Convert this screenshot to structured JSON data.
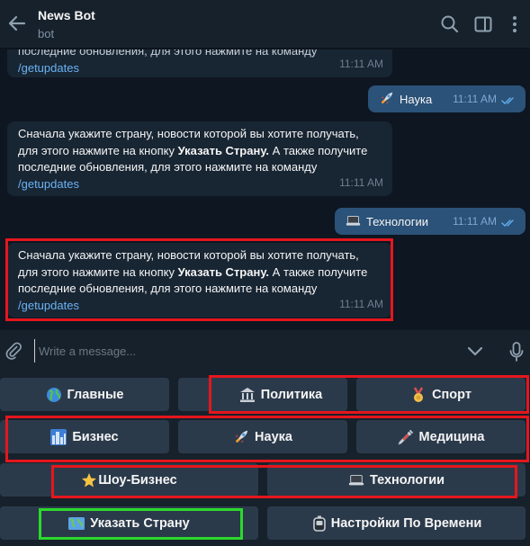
{
  "header": {
    "title": "News Bot",
    "subtitle": "bot"
  },
  "chat": {
    "top_message": {
      "line1": "последние обновления, для этого нажмите на команду",
      "cmd": "/getupdates",
      "time": "11:11 AM"
    },
    "out1": {
      "text": "Наука",
      "time": "11:11 AM"
    },
    "msg2": {
      "line1": "Сначала укажите страну, новости которой вы хотите получать,",
      "line2a": "для этого нажмите на кнопку ",
      "line2b": "Указать Страну.",
      "line2c": " А также получите",
      "line3": "последние обновления, для этого нажмите на команду",
      "cmd": "/getupdates",
      "time": "11:11 AM"
    },
    "out2": {
      "text": "Технологии",
      "time": "11:11 AM"
    },
    "msg3": {
      "line1": "Сначала укажите страну, новости которой вы хотите получать,",
      "line2a": "для этого нажмите на кнопку ",
      "line2b": "Указать Страну.",
      "line2c": " А также получите",
      "line3": "последние обновления, для этого нажмите на команду",
      "cmd": "/getupdates",
      "time": "11:11 AM"
    }
  },
  "input": {
    "placeholder": "Write a message..."
  },
  "keyboard": {
    "row1": [
      "Главные",
      "",
      "Политика",
      "Спорт"
    ],
    "row2": [
      "Бизнес",
      "Наука",
      "Медицина"
    ],
    "row3": [
      "Шоу-Бизнес",
      "Технологии"
    ],
    "row4": [
      "Указать Страну",
      "Настройки По Времени"
    ]
  },
  "colors": {
    "highlight_red": "#e5161d",
    "highlight_green": "#2bd92b",
    "accent": "#6ab3f3"
  }
}
